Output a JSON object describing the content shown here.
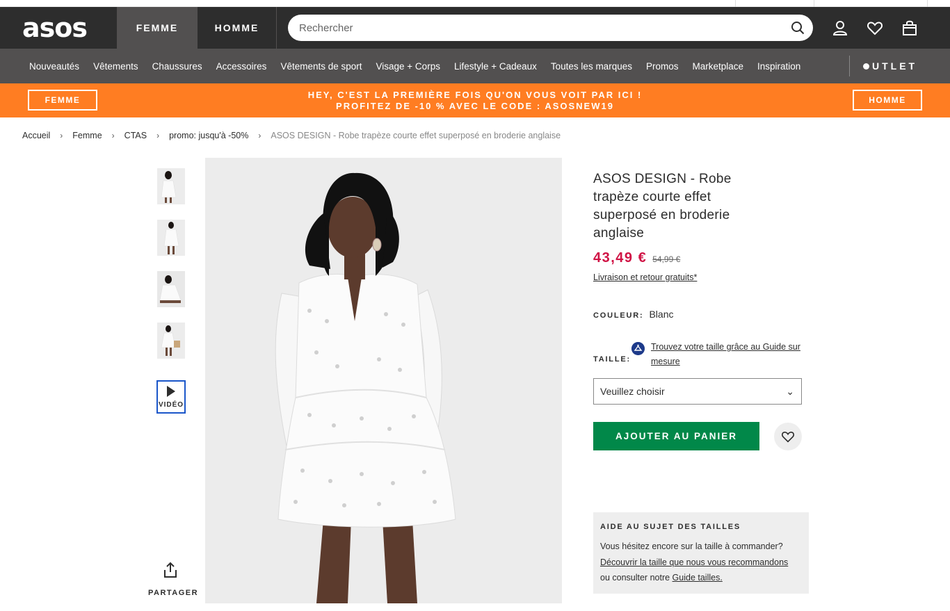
{
  "header": {
    "logo": "asos",
    "tabs": [
      "FEMME",
      "HOMME"
    ],
    "search_placeholder": "Rechercher",
    "icons": [
      "account-icon",
      "wishlist-icon",
      "bag-icon"
    ]
  },
  "nav": {
    "items": [
      "Nouveautés",
      "Vêtements",
      "Chaussures",
      "Accessoires",
      "Vêtements de sport",
      "Visage + Corps",
      "Lifestyle + Cadeaux",
      "Toutes les marques",
      "Promos",
      "Marketplace",
      "Inspiration"
    ],
    "outlet": "UTLET"
  },
  "promo": {
    "left_button": "FEMME",
    "right_button": "HOMME",
    "line1": "HEY, C'EST LA PREMIÈRE FOIS QU'ON VOUS VOIT PAR ICI !",
    "line2": "PROFITEZ DE -10 % AVEC LE CODE : ASOSNEW19"
  },
  "breadcrumb": [
    "Accueil",
    "Femme",
    "CTAS",
    "promo: jusqu'à -50%",
    "ASOS DESIGN - Robe trapèze courte effet superposé en broderie anglaise"
  ],
  "gallery": {
    "video_label": "VIDÉO",
    "share_label": "PARTAGER"
  },
  "product": {
    "title": "ASOS DESIGN - Robe trapèze courte effet superposé en broderie anglaise",
    "price": "43,49 €",
    "old_price": "54,99 €",
    "delivery": "Livraison et retour gratuits*",
    "color_label": "COULEUR:",
    "color_value": "Blanc",
    "size_label": "TAILLE:",
    "fit_link": "Trouvez votre taille grâce au Guide sur mesure",
    "size_select": "Veuillez choisir",
    "add_to_bag": "AJOUTER AU PANIER",
    "accent_price_color": "#d01345",
    "accent_button_color": "#018849"
  },
  "help": {
    "title": "AIDE AU SUJET DES TAILLES",
    "question": "Vous hésitez encore sur la taille à commander?",
    "link1": "Découvrir la taille que nous vous recommandons",
    "prefix2": "ou consulter notre ",
    "link2": "Guide tailles."
  }
}
